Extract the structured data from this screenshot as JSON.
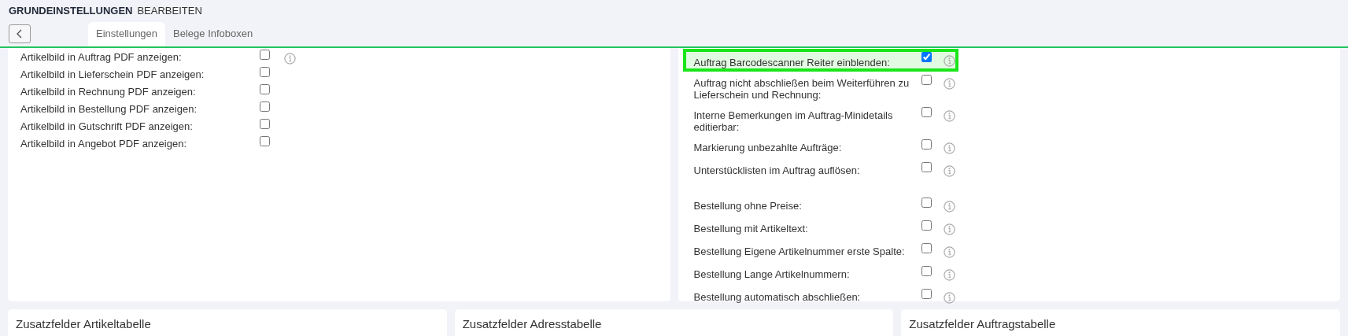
{
  "header": {
    "title": "GRUNDEINSTELLUNGEN",
    "subtitle": "BEARBEITEN"
  },
  "tabs": [
    {
      "label": "Einstellungen",
      "selected": true
    },
    {
      "label": "Belege Infoboxen",
      "selected": false
    }
  ],
  "left_panel": {
    "rows": [
      {
        "label": "Artikelbild in Auftrag PDF anzeigen:",
        "checked": false,
        "info": true
      },
      {
        "label": "Artikelbild in Lieferschein PDF anzeigen:",
        "checked": false,
        "info": false
      },
      {
        "label": "Artikelbild in Rechnung PDF anzeigen:",
        "checked": false,
        "info": false
      },
      {
        "label": "Artikelbild in Bestellung PDF anzeigen:",
        "checked": false,
        "info": false
      },
      {
        "label": "Artikelbild in Gutschrift PDF anzeigen:",
        "checked": false,
        "info": false
      },
      {
        "label": "Artikelbild in Angebot PDF anzeigen:",
        "checked": false,
        "info": false
      }
    ]
  },
  "right_panel": {
    "groups": [
      {
        "rows": [
          {
            "label": "Auftrag Barcodescanner Reiter einblenden:",
            "checked": true,
            "highlighted": true,
            "info": true
          },
          {
            "label": "Auftrag nicht abschließen beim Weiterführen zu Lieferschein und Rechnung:",
            "checked": false,
            "highlighted": false,
            "info": true
          },
          {
            "label": "Interne Bemerkungen im Auftrag-Minidetails editierbar:",
            "checked": false,
            "highlighted": false,
            "info": true
          },
          {
            "label": "Markierung unbezahlte Aufträge:",
            "checked": false,
            "highlighted": false,
            "info": true
          },
          {
            "label": "Unterstücklisten im Auftrag auflösen:",
            "checked": false,
            "highlighted": false,
            "info": true
          }
        ]
      },
      {
        "rows": [
          {
            "label": "Bestellung ohne Preise:",
            "checked": false,
            "highlighted": false,
            "info": true
          },
          {
            "label": "Bestellung mit Artikeltext:",
            "checked": false,
            "highlighted": false,
            "info": true
          },
          {
            "label": "Bestellung Eigene Artikelnummer erste Spalte:",
            "checked": false,
            "highlighted": false,
            "info": true
          },
          {
            "label": "Bestellung Lange Artikelnummern:",
            "checked": false,
            "highlighted": false,
            "info": true
          },
          {
            "label": "Bestellung automatisch abschließen:",
            "checked": false,
            "highlighted": false,
            "info": true
          }
        ]
      }
    ]
  },
  "bottom_cards": [
    {
      "title": "Zusatzfelder Artikeltabelle"
    },
    {
      "title": "Zusatzfelder Adresstabelle"
    },
    {
      "title": "Zusatzfelder Auftragstabelle"
    }
  ]
}
